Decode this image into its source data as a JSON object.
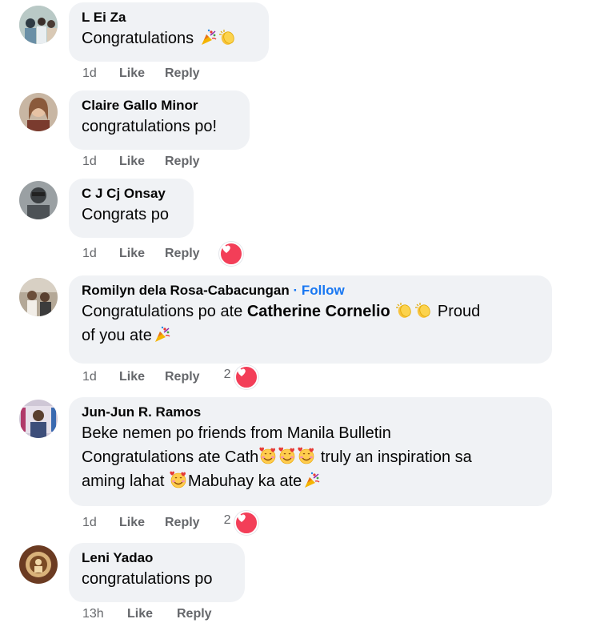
{
  "comments": [
    {
      "name": "L Ei Za",
      "text": "Congratulations",
      "time": "1d",
      "like": "Like",
      "reply": "Reply",
      "emojis": [
        "party-popper",
        "clapping-hands"
      ]
    },
    {
      "name": "Claire Gallo Minor",
      "text": "congratulations po!",
      "time": "1d",
      "like": "Like",
      "reply": "Reply"
    },
    {
      "name": "C J Cj Onsay",
      "text": "Congrats po",
      "time": "1d",
      "like": "Like",
      "reply": "Reply",
      "reaction": "heart"
    },
    {
      "name": "Romilyn dela Rosa-Cabacungan",
      "follow": "· Follow",
      "text_before": "Congratulations po ate",
      "mention": "Catherine Cornelio",
      "text_after": "Proud",
      "text_line2": "of you ate",
      "time": "1d",
      "like": "Like",
      "reply": "Reply",
      "reaction_count": "2"
    },
    {
      "name": "Jun-Jun R. Ramos",
      "line1": "Beke nemen po friends from Manila Bulletin",
      "line2a": "Congratulations ate Cath",
      "line2b": "truly an inspiration sa",
      "line3a": "aming lahat",
      "line3b": "Mabuhay ka ate",
      "time": "1d",
      "like": "Like",
      "reply": "Reply",
      "reaction_count": "2"
    },
    {
      "name": "Leni Yadao",
      "text": "congratulations po",
      "time": "13h",
      "like": "Like",
      "reply": "Reply"
    }
  ],
  "colors": {
    "bubble": "#f0f2f5",
    "meta": "#65676b",
    "follow": "#1877f2",
    "heart": "#f33e58"
  }
}
